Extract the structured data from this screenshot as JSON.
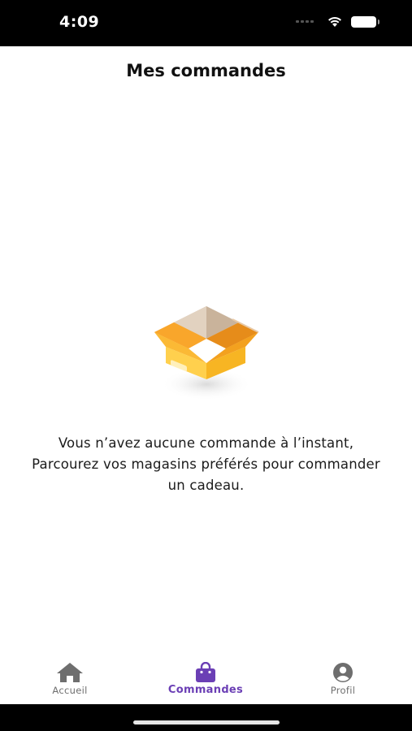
{
  "status_bar": {
    "time": "4:09",
    "icons": [
      "signal-icon",
      "wifi-icon",
      "battery-icon"
    ]
  },
  "header": {
    "title": "Mes commandes"
  },
  "empty_state": {
    "illustration": "open-box-icon",
    "lines": [
      "Vous n’avez aucune commande à l’instant,",
      "Parcourez vos magasins préférés pour commander",
      "un cadeau."
    ]
  },
  "tab_bar": {
    "tabs": [
      {
        "label": "Accueil",
        "icon": "home-icon",
        "active": false
      },
      {
        "label": "Commandes",
        "icon": "shopping-bag-icon",
        "active": true
      },
      {
        "label": "Profil",
        "icon": "user-circle-icon",
        "active": false
      }
    ]
  },
  "colors": {
    "accent": "#6b3fb5",
    "inactive": "#6e6e6e",
    "box_orange": "#f6a623",
    "box_light": "#ffce4d",
    "box_flap": "#d8c3aa"
  }
}
